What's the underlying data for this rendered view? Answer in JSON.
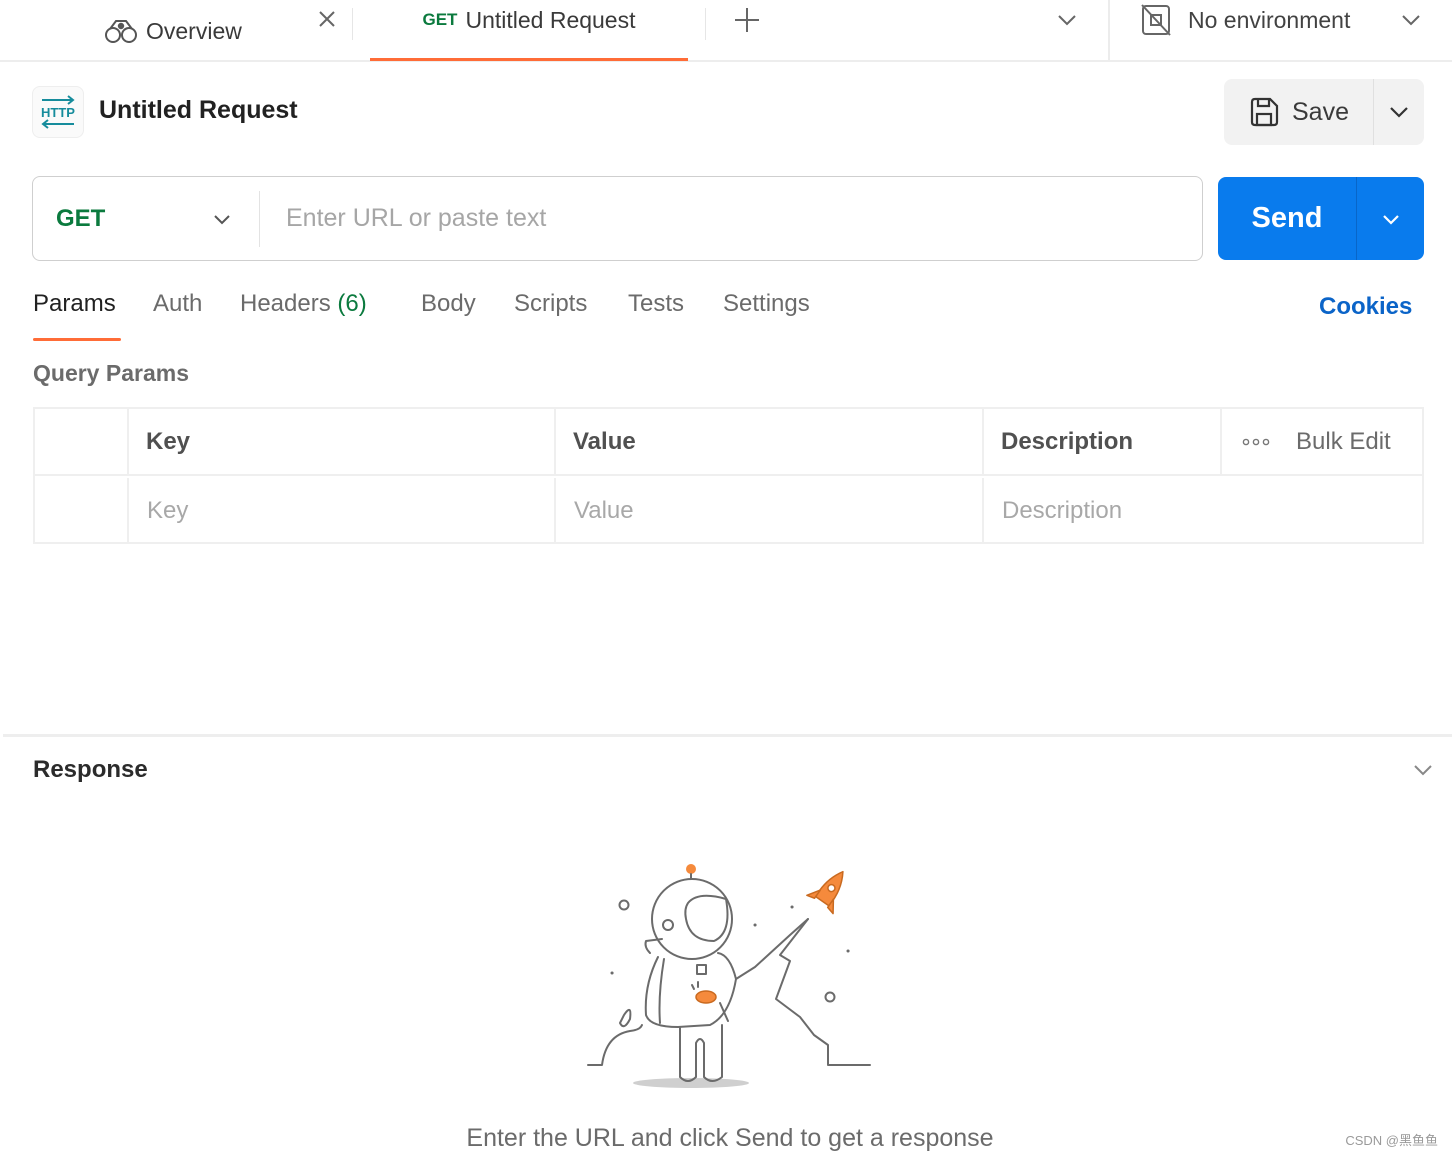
{
  "tabbar": {
    "tabs": [
      {
        "label": "Overview",
        "icon": "binoculars-icon",
        "closable": true
      },
      {
        "method": "GET",
        "label": "Untitled Request",
        "active": true
      }
    ],
    "add_tab_icon": "plus-icon",
    "overflow_icon": "chevron-down-icon",
    "environment": {
      "label": "No environment",
      "icon": "no-environment-icon"
    }
  },
  "request": {
    "icon_text": "HTTP",
    "title": "Untitled Request",
    "save_label": "Save",
    "method": "GET",
    "url": "",
    "url_placeholder": "Enter URL or paste text",
    "send_label": "Send"
  },
  "subtabs": {
    "items": [
      {
        "label": "Params",
        "active": true
      },
      {
        "label": "Auth"
      },
      {
        "label": "Headers",
        "count": "(6)"
      },
      {
        "label": "Body"
      },
      {
        "label": "Scripts"
      },
      {
        "label": "Tests"
      },
      {
        "label": "Settings"
      }
    ],
    "cookies_label": "Cookies"
  },
  "params": {
    "section_title": "Query Params",
    "columns": [
      "Key",
      "Value",
      "Description"
    ],
    "bulk_edit_label": "Bulk Edit",
    "more_icon": "ellipsis-icon",
    "placeholders": {
      "key": "Key",
      "value": "Value",
      "description": "Description"
    }
  },
  "response": {
    "title": "Response",
    "hint": "Enter the URL and click Send to get a response",
    "illustration": "astronaut-rocket-illustration"
  },
  "watermark": "CSDN @黑鱼鱼",
  "colors": {
    "accent": "#ff6c37",
    "send": "#097bed",
    "get_method": "#0b7a3e",
    "link": "#0b64c8"
  }
}
